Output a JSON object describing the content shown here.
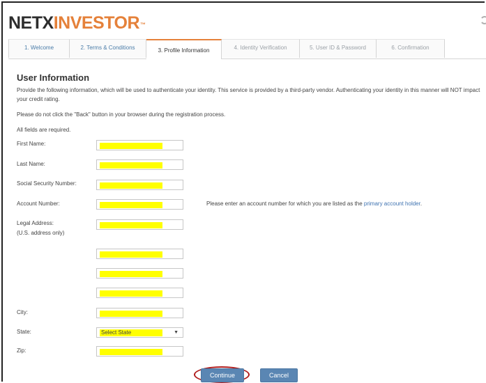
{
  "logo": {
    "part1": "NETX",
    "part2": "INVESTOR",
    "mark": "™"
  },
  "tabs": [
    {
      "label": "1. Welcome"
    },
    {
      "label": "2. Terms & Conditions"
    },
    {
      "label": "3. Profile Information"
    },
    {
      "label": "4. Identity Verification"
    },
    {
      "label": "5. User ID & Password"
    },
    {
      "label": "6. Confirmation"
    }
  ],
  "section": {
    "title": "User Information",
    "intro": "Provide the following information, which will be used to authenticate your identity. This service is provided by a third-party vendor. Authenticating your identity in this manner will NOT impact your credit rating.",
    "back_warning": "Please do not click the \"Back\" button in your browser during the registration process.",
    "required": "All fields are required."
  },
  "fields": {
    "first_name": "First Name:",
    "last_name": "Last Name:",
    "ssn": "Social Security Number:",
    "account_number": "Account Number:",
    "legal_address": "Legal Address:",
    "legal_address_note": "(U.S. address only)",
    "city": "City:",
    "state": "State:",
    "zip": "Zip:"
  },
  "account_note": {
    "text": "Please enter an account number for which you are listed as the ",
    "link": "primary account holder",
    "end": "."
  },
  "state_select": {
    "value": "Select State"
  },
  "buttons": {
    "continue": "Continue",
    "cancel": "Cancel"
  },
  "colors": {
    "accent": "#e5813a",
    "link": "#3e72b0",
    "button": "#5a86b3",
    "highlight": "#ffff00",
    "annotation": "#b01c1c"
  }
}
